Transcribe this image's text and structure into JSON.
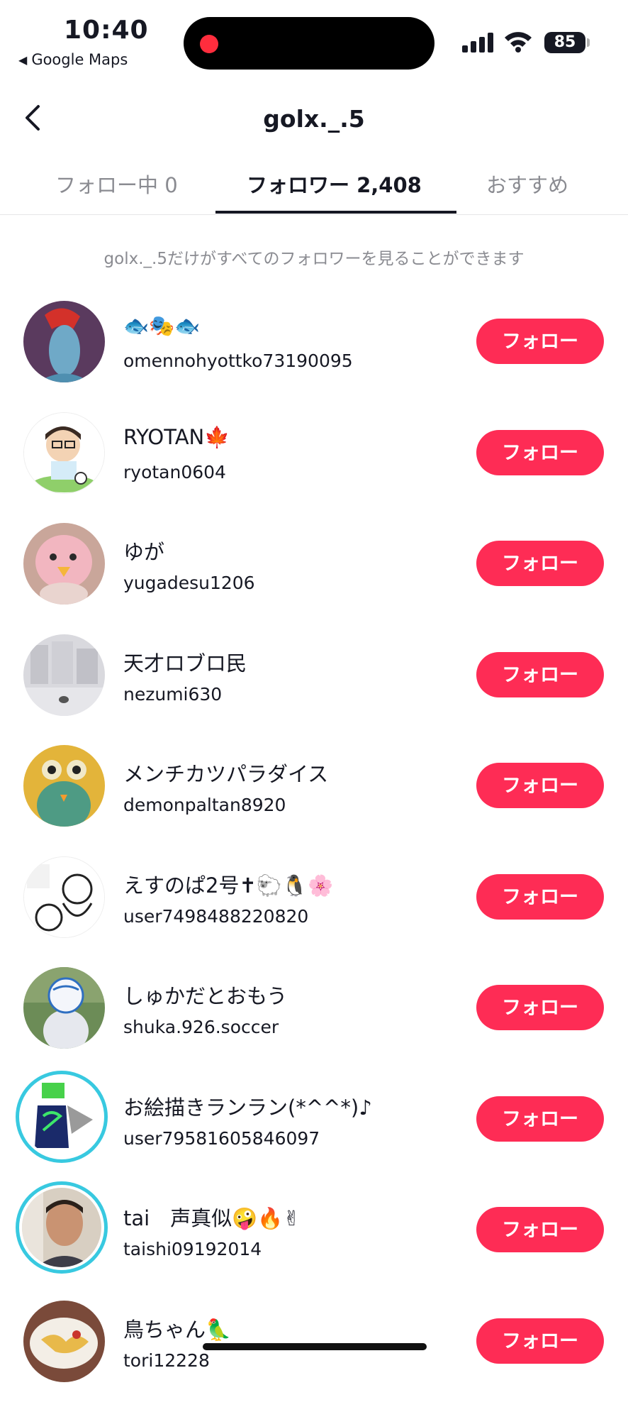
{
  "status_bar": {
    "time": "10:40",
    "back_app": "Google Maps",
    "battery": "85"
  },
  "header": {
    "title": "golx._.5"
  },
  "tabs": [
    {
      "label": "フォロー中 0",
      "active": false
    },
    {
      "label": "フォロワー 2,408",
      "active": true
    },
    {
      "label": "おすすめ",
      "active": false
    }
  ],
  "notice": "golx._.5だけがすべてのフォロワーを見ることができます",
  "follow_label": "フォロー",
  "followers": [
    {
      "name": "🐟🎭🐟",
      "handle": "omennohyottko73190095"
    },
    {
      "name": "RYOTAN🍁",
      "handle": "ryotan0604"
    },
    {
      "name": "ゆが",
      "handle": "yugadesu1206"
    },
    {
      "name": "天才ロブロ民",
      "handle": "nezumi630"
    },
    {
      "name": "メンチカツパラダイス",
      "handle": "demonpaltan8920"
    },
    {
      "name": "えすのぱ2号✝🐑🐧🌸",
      "handle": "user7498488220820"
    },
    {
      "name": "しゅかだとおもう",
      "handle": "shuka.926.soccer"
    },
    {
      "name": "お絵描きランラン(*^^*)♪",
      "handle": "user79581605846097"
    },
    {
      "name": "tai　声真似🤪🔥✌",
      "handle": "taishi09192014"
    },
    {
      "name": "鳥ちゃん🦜",
      "handle": "tori12228"
    }
  ]
}
